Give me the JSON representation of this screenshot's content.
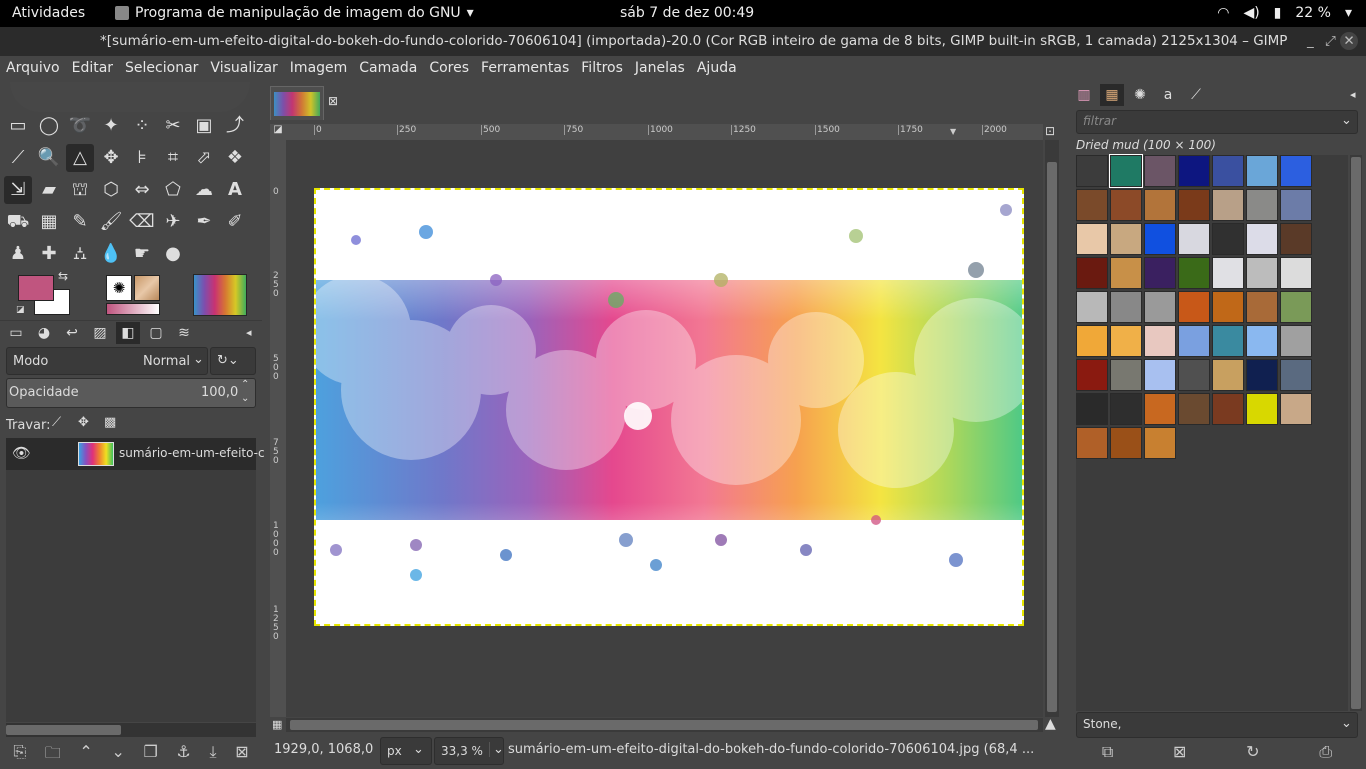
{
  "topbar": {
    "activities": "Atividades",
    "app_name": "Programa de manipulação de imagem do GNU",
    "clock": "sáb 7 de dez  00:49",
    "battery": "22 %"
  },
  "window": {
    "title": "*[sumário-em-um-efeito-digital-do-bokeh-do-fundo-colorido-70606104] (importada)-20.0 (Cor RGB inteiro de gama de 8 bits, GIMP built-in sRGB, 1 camada) 2125x1304 – GIMP"
  },
  "menu": [
    "Arquivo",
    "Editar",
    "Selecionar",
    "Visualizar",
    "Imagem",
    "Camada",
    "Cores",
    "Ferramentas",
    "Filtros",
    "Janelas",
    "Ajuda"
  ],
  "layers": {
    "mode_label": "Modo",
    "mode_value": "Normal",
    "opacity_label": "Opacidade",
    "opacity_value": "100,0",
    "lock_label": "Travar:",
    "layer_name": "sumário-em-um-efeito-c"
  },
  "rulers": {
    "h_ticks": [
      "0",
      "250",
      "500",
      "750",
      "1000",
      "1250",
      "1500",
      "1750",
      "2000"
    ],
    "v_ticks": [
      "0",
      "2\n5\n0",
      "5\n0\n0",
      "7\n5\n0",
      "1\n0\n0\n0",
      "1\n2\n5\n0"
    ]
  },
  "status": {
    "coords": "1929,0, 1068,0",
    "unit": "px",
    "zoom": "33,3 %",
    "file": "sumário-em-um-efeito-digital-do-bokeh-do-fundo-colorido-70606104.jpg (68,4 ..."
  },
  "patterns": {
    "filter_placeholder": "filtrar",
    "current": "Dried mud (100 × 100)",
    "bottom_select": "Stone,",
    "swatches": [
      "#3c3c3c",
      "#1f7a64",
      "#6b5566",
      "#0d1680",
      "#3a50a0",
      "#6aa6d8",
      "#2c5fe0",
      "#7a4a2a",
      "#8c4a28",
      "#b2743a",
      "#7a3a1a",
      "#b8a088",
      "#8a8a88",
      "#6c7ca8",
      "#e8c8a8",
      "#c8a880",
      "#1050e0",
      "#d8d8e0",
      "#303030",
      "#dcdce8",
      "#5a3a28",
      "#6a1a10",
      "#c89048",
      "#3a2060",
      "#3a6a18",
      "#e0e0e4",
      "#bcbcbc",
      "#dcdcdc",
      "#b8b8b8",
      "#888888",
      "#9a9a9a",
      "#c85818",
      "#c06818",
      "#a86a38",
      "#7a9a58",
      "#f0a838",
      "#f0b048",
      "#e8c8c0",
      "#7aa0e0",
      "#3a8aa0",
      "#8ab8f0",
      "#a0a0a0",
      "#8a1a10",
      "#787870",
      "#a8c0f0",
      "#505050",
      "#c8a060",
      "#102050",
      "#5a6a80",
      "#2a2a2a",
      "#2e2e2e",
      "#c86820",
      "#6a4a30",
      "#7a3a20",
      "#d8d800",
      "#c8a888",
      "#b06028",
      "#9a5018",
      "#c88030"
    ]
  },
  "colors": {
    "fg": "#c0557f",
    "bg": "#ffffff",
    "accent": "#e6e600"
  }
}
